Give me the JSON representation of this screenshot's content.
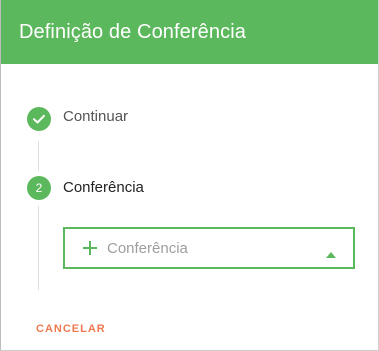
{
  "dialog": {
    "title": "Definição de Conferência"
  },
  "steps": [
    {
      "label": "Continuar",
      "state": "completed",
      "icon": "check-icon"
    },
    {
      "number": "2",
      "label": "Conferência",
      "state": "active"
    }
  ],
  "select": {
    "placeholder": "Conferência",
    "icon": "plus-icon",
    "caret": "caret-up-icon"
  },
  "actions": {
    "cancel_label": "CANCELAR"
  },
  "colors": {
    "accent": "#5cb85c",
    "cancel": "#ef7a51",
    "header_text": "#ffffff",
    "placeholder": "#9e9e9e"
  }
}
